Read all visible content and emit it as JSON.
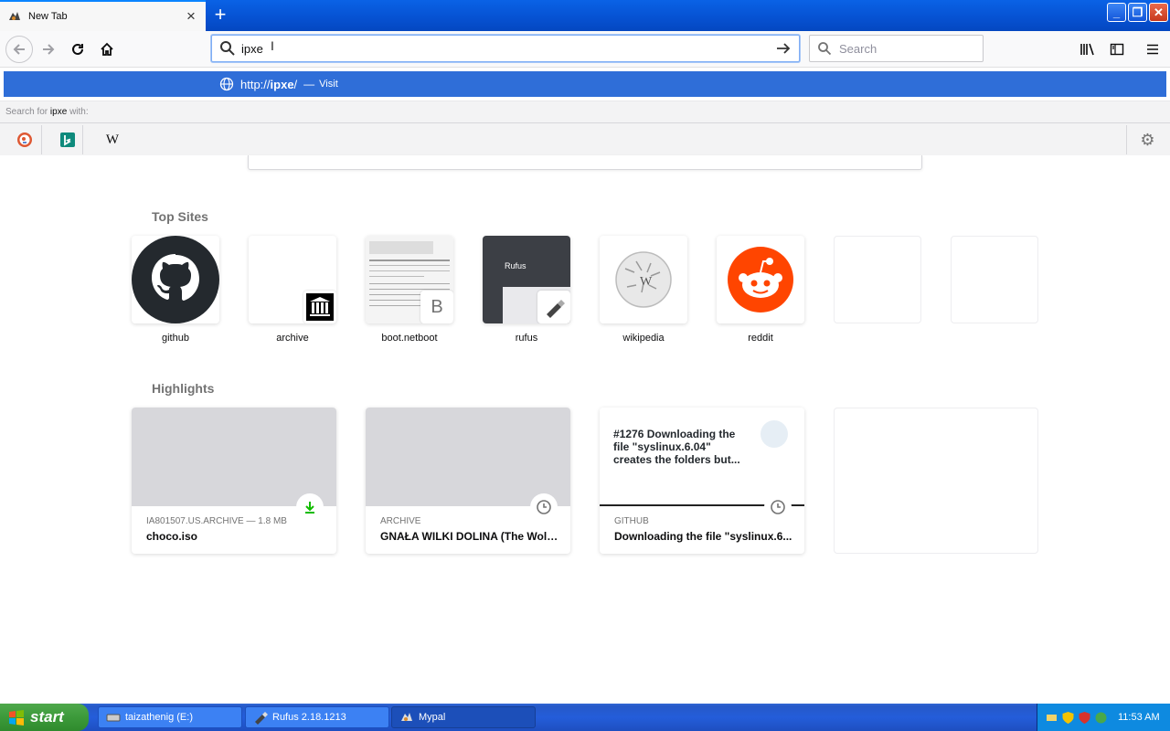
{
  "browser": {
    "tab": {
      "title": "New Tab"
    },
    "urlbar": {
      "value": "ipxe"
    },
    "search": {
      "placeholder": "Search"
    }
  },
  "popup": {
    "suggestion": {
      "url_prefix": "http://",
      "url_bold": "ipxe",
      "url_suffix": "/",
      "separator": "—",
      "action": "Visit"
    },
    "search_with": {
      "prefix": "Search for",
      "term": "ipxe",
      "suffix": "with:"
    },
    "engines": [
      "duckduckgo-icon",
      "bing-icon",
      "wikipedia-icon"
    ],
    "wiki_glyph": "W"
  },
  "content": {
    "topsites_title": "Top Sites",
    "highlights_title": "Highlights",
    "topsites": [
      {
        "label": "github"
      },
      {
        "label": "archive"
      },
      {
        "label": "boot.netboot",
        "letter": "B"
      },
      {
        "label": "rufus",
        "thumb_text": "Rufus"
      },
      {
        "label": "wikipedia"
      },
      {
        "label": "reddit"
      }
    ],
    "highlights": [
      {
        "context": "IA801507.US.ARCHIVE — 1.8 MB",
        "title": "choco.iso"
      },
      {
        "context": "ARCHIVE",
        "title": "GNAŁA WILKI DOLINA (The Wolf..."
      },
      {
        "context": "GITHUB",
        "title": "Downloading the file \"syslinux.6...",
        "thumb_heading": "#1276 Downloading the file \"syslinux.6.04\" creates the folders but..."
      }
    ]
  },
  "taskbar": {
    "start_label": "start",
    "tasks": [
      {
        "label": "taizathenig (E:)"
      },
      {
        "label": "Rufus 2.18.1213"
      },
      {
        "label": "Mypal"
      }
    ],
    "clock": "11:53 AM"
  },
  "colors": {
    "accent": "#0a84ff",
    "suggestion_bg": "#2f6ed8",
    "reddit": "#ff4500",
    "taskbar": "#245dda",
    "start": "#3c9a3a"
  }
}
